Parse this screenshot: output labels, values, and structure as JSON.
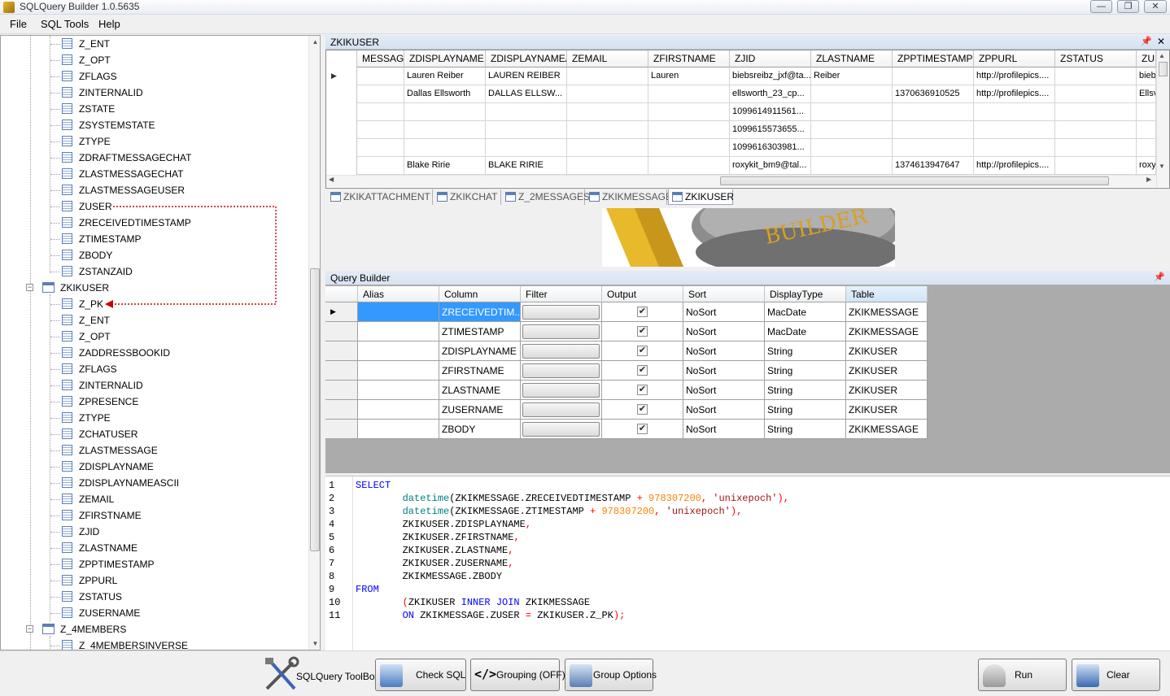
{
  "window": {
    "title": "SQLQuery Builder 1.0.5635",
    "buttons": [
      "—",
      "❐",
      "✕"
    ]
  },
  "menu": [
    "File",
    "SQL Tools",
    "Help"
  ],
  "tree": {
    "group1_items": [
      "Z_ENT",
      "Z_OPT",
      "ZFLAGS",
      "ZINTERNALID",
      "ZSTATE",
      "ZSYSTEMSTATE",
      "ZTYPE",
      "ZDRAFTMESSAGECHAT",
      "ZLASTMESSAGECHAT",
      "ZLASTMESSAGEUSER",
      "ZUSER",
      "ZRECEIVEDTIMESTAMP",
      "ZTIMESTAMP",
      "ZBODY",
      "ZSTANZAID"
    ],
    "table2": "ZKIKUSER",
    "group2_items": [
      "Z_PK",
      "Z_ENT",
      "Z_OPT",
      "ZADDRESSBOOKID",
      "ZFLAGS",
      "ZINTERNALID",
      "ZPRESENCE",
      "ZTYPE",
      "ZCHATUSER",
      "ZLASTMESSAGE",
      "ZDISPLAYNAME",
      "ZDISPLAYNAMEASCII",
      "ZEMAIL",
      "ZFIRSTNAME",
      "ZJID",
      "ZLASTNAME",
      "ZPPTIMESTAMP",
      "ZPPURL",
      "ZSTATUS",
      "ZUSERNAME"
    ],
    "table3": "Z_4MEMBERS",
    "group3_items": [
      "Z_4MEMBERSINVERSE"
    ]
  },
  "data_panel": {
    "title": "ZKIKUSER",
    "columns": [
      "MESSAGE",
      "ZDISPLAYNAME",
      "ZDISPLAYNAMEA",
      "ZEMAIL",
      "ZFIRSTNAME",
      "ZJID",
      "ZLASTNAME",
      "ZPPTIMESTAMP",
      "ZPPURL",
      "ZSTATUS",
      "ZUS"
    ],
    "rows": [
      [
        "",
        "Lauren Reiber",
        "LAUREN REIBER",
        "",
        "Lauren",
        "biebsreibz_jxf@ta...",
        "Reiber",
        "",
        "http://profilepics....",
        "",
        "bieb"
      ],
      [
        "",
        "Dallas Ellsworth",
        "DALLAS ELLSW...",
        "",
        "",
        "ellsworth_23_cp...",
        "",
        "1370636910525",
        "http://profilepics....",
        "",
        "Ellsv"
      ],
      [
        "",
        "",
        "",
        "",
        "",
        "1099614911561...",
        "",
        "",
        "",
        "",
        ""
      ],
      [
        "",
        "",
        "",
        "",
        "",
        "1099615573655...",
        "",
        "",
        "",
        "",
        ""
      ],
      [
        "",
        "",
        "",
        "",
        "",
        "1099616303981...",
        "",
        "",
        "",
        "",
        ""
      ],
      [
        "",
        "Blake Ririe",
        "BLAKE RIRIE",
        "",
        "",
        "roxykit_bm9@tal...",
        "",
        "1374613947647",
        "http://profilepics....",
        "",
        "roxyl"
      ]
    ]
  },
  "tabs": [
    "ZKIKATTACHMENT",
    "ZKIKCHAT",
    "Z_2MESSAGES",
    "ZKIKMESSAGE",
    "ZKIKUSER"
  ],
  "active_tab": "ZKIKUSER",
  "logo_text": "BUILDER",
  "query_builder": {
    "title": "Query Builder",
    "columns": [
      "Alias",
      "Column",
      "Filter",
      "Output",
      "Sort",
      "DisplayType",
      "Table"
    ],
    "rows": [
      {
        "alias": "",
        "column": "ZRECEIVEDTIM...",
        "output": "✔",
        "sort": "NoSort",
        "display": "MacDate",
        "table": "ZKIKMESSAGE"
      },
      {
        "alias": "",
        "column": "ZTIMESTAMP",
        "output": "✔",
        "sort": "NoSort",
        "display": "MacDate",
        "table": "ZKIKMESSAGE"
      },
      {
        "alias": "",
        "column": "ZDISPLAYNAME",
        "output": "✔",
        "sort": "NoSort",
        "display": "String",
        "table": "ZKIKUSER"
      },
      {
        "alias": "",
        "column": "ZFIRSTNAME",
        "output": "✔",
        "sort": "NoSort",
        "display": "String",
        "table": "ZKIKUSER"
      },
      {
        "alias": "",
        "column": "ZLASTNAME",
        "output": "✔",
        "sort": "NoSort",
        "display": "String",
        "table": "ZKIKUSER"
      },
      {
        "alias": "",
        "column": "ZUSERNAME",
        "output": "✔",
        "sort": "NoSort",
        "display": "String",
        "table": "ZKIKUSER"
      },
      {
        "alias": "",
        "column": "ZBODY",
        "output": "✔",
        "sort": "NoSort",
        "display": "String",
        "table": "ZKIKMESSAGE"
      }
    ]
  },
  "sql_lines": [
    {
      "n": "1",
      "t": [
        [
          "kw",
          "SELECT"
        ]
      ]
    },
    {
      "n": "2",
      "t": [
        [
          "",
          "        "
        ],
        [
          "fn",
          "datetime"
        ],
        [
          "",
          "(ZKIKMESSAGE.ZRECEIVEDTIMESTAMP "
        ],
        [
          "op",
          "+"
        ],
        [
          "num",
          " 978307200"
        ],
        [
          "op",
          ","
        ],
        [
          "str",
          " 'unixepoch'"
        ],
        [
          "op",
          "),"
        ]
      ]
    },
    {
      "n": "3",
      "t": [
        [
          "",
          "        "
        ],
        [
          "fn",
          "datetime"
        ],
        [
          "",
          "(ZKIKMESSAGE.ZTIMESTAMP "
        ],
        [
          "op",
          "+"
        ],
        [
          "num",
          " 978307200"
        ],
        [
          "op",
          ","
        ],
        [
          "str",
          " 'unixepoch'"
        ],
        [
          "op",
          "),"
        ]
      ]
    },
    {
      "n": "4",
      "t": [
        [
          "",
          "        ZKIKUSER.ZDISPLAYNAME"
        ],
        [
          "op",
          ","
        ]
      ]
    },
    {
      "n": "5",
      "t": [
        [
          "",
          "        ZKIKUSER.ZFIRSTNAME"
        ],
        [
          "op",
          ","
        ]
      ]
    },
    {
      "n": "6",
      "t": [
        [
          "",
          "        ZKIKUSER.ZLASTNAME"
        ],
        [
          "op",
          ","
        ]
      ]
    },
    {
      "n": "7",
      "t": [
        [
          "",
          "        ZKIKUSER.ZUSERNAME"
        ],
        [
          "op",
          ","
        ]
      ]
    },
    {
      "n": "8",
      "t": [
        [
          "",
          "        ZKIKMESSAGE.ZBODY"
        ]
      ]
    },
    {
      "n": "9",
      "t": [
        [
          "kw",
          "FROM"
        ]
      ]
    },
    {
      "n": "10",
      "t": [
        [
          "",
          "        "
        ],
        [
          "op",
          "("
        ],
        [
          "",
          "ZKIKUSER "
        ],
        [
          "kw",
          "INNER JOIN"
        ],
        [
          "",
          " ZKIKMESSAGE"
        ]
      ]
    },
    {
      "n": "11",
      "t": [
        [
          "",
          "        "
        ],
        [
          "kw",
          "ON"
        ],
        [
          "",
          " ZKIKMESSAGE.ZUSER "
        ],
        [
          "op",
          "="
        ],
        [
          "",
          " ZKIKUSER.Z_PK"
        ],
        [
          "op",
          ");"
        ]
      ]
    }
  ],
  "toolbar": {
    "toolbox": "SQLQuery ToolBox",
    "check_sql": "Check SQL",
    "grouping": "Grouping (OFF)",
    "group_options": "Group Options",
    "run": "Run",
    "clear": "Clear"
  },
  "colors": {
    "selection": "#3399ff",
    "relation_line": "#cc0000",
    "panel_header": "#d5e1f0"
  }
}
